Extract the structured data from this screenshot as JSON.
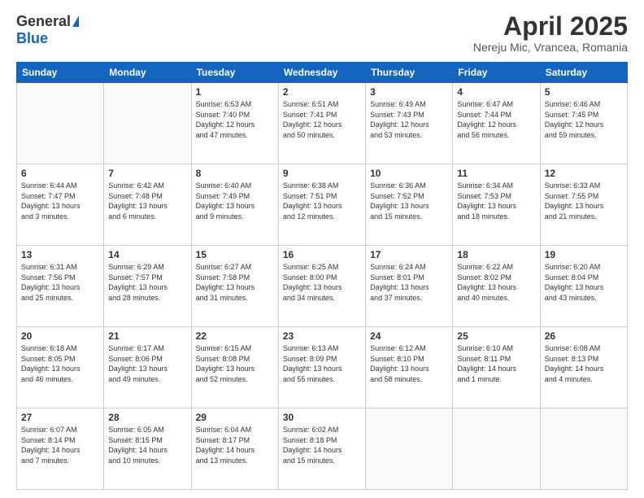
{
  "logo": {
    "general": "General",
    "blue": "Blue"
  },
  "header": {
    "month": "April 2025",
    "location": "Nereju Mic, Vrancea, Romania"
  },
  "weekdays": [
    "Sunday",
    "Monday",
    "Tuesday",
    "Wednesday",
    "Thursday",
    "Friday",
    "Saturday"
  ],
  "weeks": [
    [
      {
        "day": "",
        "info": ""
      },
      {
        "day": "",
        "info": ""
      },
      {
        "day": "1",
        "info": "Sunrise: 6:53 AM\nSunset: 7:40 PM\nDaylight: 12 hours\nand 47 minutes."
      },
      {
        "day": "2",
        "info": "Sunrise: 6:51 AM\nSunset: 7:41 PM\nDaylight: 12 hours\nand 50 minutes."
      },
      {
        "day": "3",
        "info": "Sunrise: 6:49 AM\nSunset: 7:43 PM\nDaylight: 12 hours\nand 53 minutes."
      },
      {
        "day": "4",
        "info": "Sunrise: 6:47 AM\nSunset: 7:44 PM\nDaylight: 12 hours\nand 56 minutes."
      },
      {
        "day": "5",
        "info": "Sunrise: 6:46 AM\nSunset: 7:45 PM\nDaylight: 12 hours\nand 59 minutes."
      }
    ],
    [
      {
        "day": "6",
        "info": "Sunrise: 6:44 AM\nSunset: 7:47 PM\nDaylight: 13 hours\nand 3 minutes."
      },
      {
        "day": "7",
        "info": "Sunrise: 6:42 AM\nSunset: 7:48 PM\nDaylight: 13 hours\nand 6 minutes."
      },
      {
        "day": "8",
        "info": "Sunrise: 6:40 AM\nSunset: 7:49 PM\nDaylight: 13 hours\nand 9 minutes."
      },
      {
        "day": "9",
        "info": "Sunrise: 6:38 AM\nSunset: 7:51 PM\nDaylight: 13 hours\nand 12 minutes."
      },
      {
        "day": "10",
        "info": "Sunrise: 6:36 AM\nSunset: 7:52 PM\nDaylight: 13 hours\nand 15 minutes."
      },
      {
        "day": "11",
        "info": "Sunrise: 6:34 AM\nSunset: 7:53 PM\nDaylight: 13 hours\nand 18 minutes."
      },
      {
        "day": "12",
        "info": "Sunrise: 6:33 AM\nSunset: 7:55 PM\nDaylight: 13 hours\nand 21 minutes."
      }
    ],
    [
      {
        "day": "13",
        "info": "Sunrise: 6:31 AM\nSunset: 7:56 PM\nDaylight: 13 hours\nand 25 minutes."
      },
      {
        "day": "14",
        "info": "Sunrise: 6:29 AM\nSunset: 7:57 PM\nDaylight: 13 hours\nand 28 minutes."
      },
      {
        "day": "15",
        "info": "Sunrise: 6:27 AM\nSunset: 7:58 PM\nDaylight: 13 hours\nand 31 minutes."
      },
      {
        "day": "16",
        "info": "Sunrise: 6:25 AM\nSunset: 8:00 PM\nDaylight: 13 hours\nand 34 minutes."
      },
      {
        "day": "17",
        "info": "Sunrise: 6:24 AM\nSunset: 8:01 PM\nDaylight: 13 hours\nand 37 minutes."
      },
      {
        "day": "18",
        "info": "Sunrise: 6:22 AM\nSunset: 8:02 PM\nDaylight: 13 hours\nand 40 minutes."
      },
      {
        "day": "19",
        "info": "Sunrise: 6:20 AM\nSunset: 8:04 PM\nDaylight: 13 hours\nand 43 minutes."
      }
    ],
    [
      {
        "day": "20",
        "info": "Sunrise: 6:18 AM\nSunset: 8:05 PM\nDaylight: 13 hours\nand 46 minutes."
      },
      {
        "day": "21",
        "info": "Sunrise: 6:17 AM\nSunset: 8:06 PM\nDaylight: 13 hours\nand 49 minutes."
      },
      {
        "day": "22",
        "info": "Sunrise: 6:15 AM\nSunset: 8:08 PM\nDaylight: 13 hours\nand 52 minutes."
      },
      {
        "day": "23",
        "info": "Sunrise: 6:13 AM\nSunset: 8:09 PM\nDaylight: 13 hours\nand 55 minutes."
      },
      {
        "day": "24",
        "info": "Sunrise: 6:12 AM\nSunset: 8:10 PM\nDaylight: 13 hours\nand 58 minutes."
      },
      {
        "day": "25",
        "info": "Sunrise: 6:10 AM\nSunset: 8:11 PM\nDaylight: 14 hours\nand 1 minute."
      },
      {
        "day": "26",
        "info": "Sunrise: 6:08 AM\nSunset: 8:13 PM\nDaylight: 14 hours\nand 4 minutes."
      }
    ],
    [
      {
        "day": "27",
        "info": "Sunrise: 6:07 AM\nSunset: 8:14 PM\nDaylight: 14 hours\nand 7 minutes."
      },
      {
        "day": "28",
        "info": "Sunrise: 6:05 AM\nSunset: 8:15 PM\nDaylight: 14 hours\nand 10 minutes."
      },
      {
        "day": "29",
        "info": "Sunrise: 6:04 AM\nSunset: 8:17 PM\nDaylight: 14 hours\nand 13 minutes."
      },
      {
        "day": "30",
        "info": "Sunrise: 6:02 AM\nSunset: 8:18 PM\nDaylight: 14 hours\nand 15 minutes."
      },
      {
        "day": "",
        "info": ""
      },
      {
        "day": "",
        "info": ""
      },
      {
        "day": "",
        "info": ""
      }
    ]
  ]
}
